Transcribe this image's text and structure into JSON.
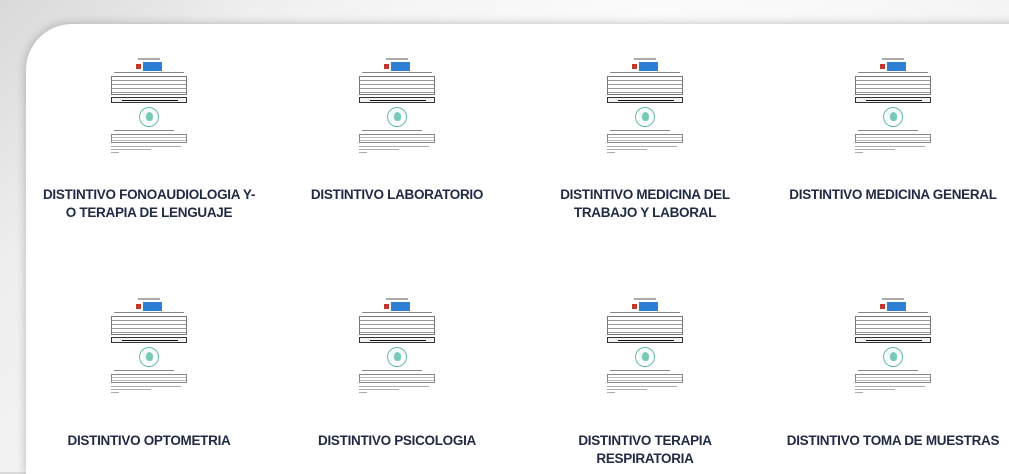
{
  "cards": [
    {
      "title": "DISTINTIVO FONOAUDIOLOGIA Y-O TERAPIA DE LENGUAJE",
      "line1": "DISTINTIVO FONOAUDIOLOGIA Y-",
      "line2": "O TERAPIA DE LENGUAJE"
    },
    {
      "title": "DISTINTIVO LABORATORIO",
      "line1": "DISTINTIVO LABORATORIO",
      "line2": ""
    },
    {
      "title": "DISTINTIVO MEDICINA DEL TRABAJO Y LABORAL",
      "line1": "DISTINTIVO MEDICINA DEL",
      "line2": "TRABAJO Y LABORAL"
    },
    {
      "title": "DISTINTIVO MEDICINA GENERAL",
      "line1": "DISTINTIVO MEDICINA GENERAL",
      "line2": ""
    },
    {
      "title": "DISTINTIVO OPTOMETRIA",
      "line1": "DISTINTIVO OPTOMETRIA",
      "line2": ""
    },
    {
      "title": "DISTINTIVO PSICOLOGIA",
      "line1": "DISTINTIVO PSICOLOGIA",
      "line2": ""
    },
    {
      "title": "DISTINTIVO TERAPIA RESPIRATORIA",
      "line1": "DISTINTIVO TERAPIA",
      "line2": "RESPIRATORIA"
    },
    {
      "title": "DISTINTIVO TOMA DE MUESTRAS",
      "line1": "DISTINTIVO TOMA DE MUESTRAS",
      "line2": ""
    }
  ]
}
